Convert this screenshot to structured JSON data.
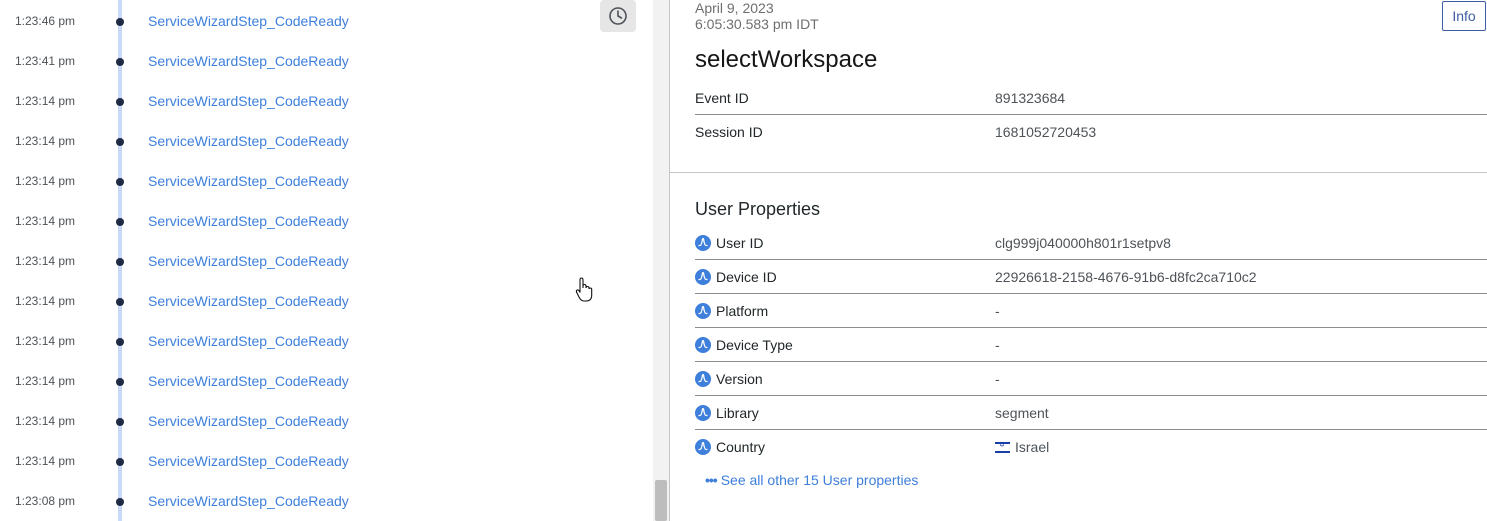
{
  "timeline": {
    "events": [
      {
        "time": "1:23:46 pm",
        "name": "ServiceWizardStep_CodeReady"
      },
      {
        "time": "1:23:41 pm",
        "name": "ServiceWizardStep_CodeReady"
      },
      {
        "time": "1:23:14 pm",
        "name": "ServiceWizardStep_CodeReady"
      },
      {
        "time": "1:23:14 pm",
        "name": "ServiceWizardStep_CodeReady"
      },
      {
        "time": "1:23:14 pm",
        "name": "ServiceWizardStep_CodeReady"
      },
      {
        "time": "1:23:14 pm",
        "name": "ServiceWizardStep_CodeReady"
      },
      {
        "time": "1:23:14 pm",
        "name": "ServiceWizardStep_CodeReady"
      },
      {
        "time": "1:23:14 pm",
        "name": "ServiceWizardStep_CodeReady"
      },
      {
        "time": "1:23:14 pm",
        "name": "ServiceWizardStep_CodeReady"
      },
      {
        "time": "1:23:14 pm",
        "name": "ServiceWizardStep_CodeReady"
      },
      {
        "time": "1:23:14 pm",
        "name": "ServiceWizardStep_CodeReady"
      },
      {
        "time": "1:23:14 pm",
        "name": "ServiceWizardStep_CodeReady"
      },
      {
        "time": "1:23:08 pm",
        "name": "ServiceWizardStep_CodeReady"
      }
    ],
    "clock_icon": "clock-icon"
  },
  "details": {
    "date_line1": "April 9, 2023",
    "date_line2": "6:05:30.583 pm IDT",
    "info_label": "Info",
    "event_name": "selectWorkspace",
    "event_props": [
      {
        "key": "Event ID",
        "value": "891323684"
      },
      {
        "key": "Session ID",
        "value": "1681052720453"
      }
    ],
    "user_props_title": "User Properties",
    "user_props": [
      {
        "key": "User ID",
        "value": "clg999j040000h801r1setpv8"
      },
      {
        "key": "Device ID",
        "value": "22926618-2158-4676-91b6-d8fc2ca710c2"
      },
      {
        "key": "Platform",
        "value": "-"
      },
      {
        "key": "Device Type",
        "value": "-"
      },
      {
        "key": "Version",
        "value": "-"
      },
      {
        "key": "Library",
        "value": "segment"
      },
      {
        "key": "Country",
        "value": "Israel"
      }
    ],
    "see_all_label": "See all other 15 User properties"
  },
  "colors": {
    "link": "#3d7fdb",
    "timeline_dot": "#1f2a44",
    "timeline_line": "#c9d9f7",
    "info_border": "#3e5fa3"
  }
}
